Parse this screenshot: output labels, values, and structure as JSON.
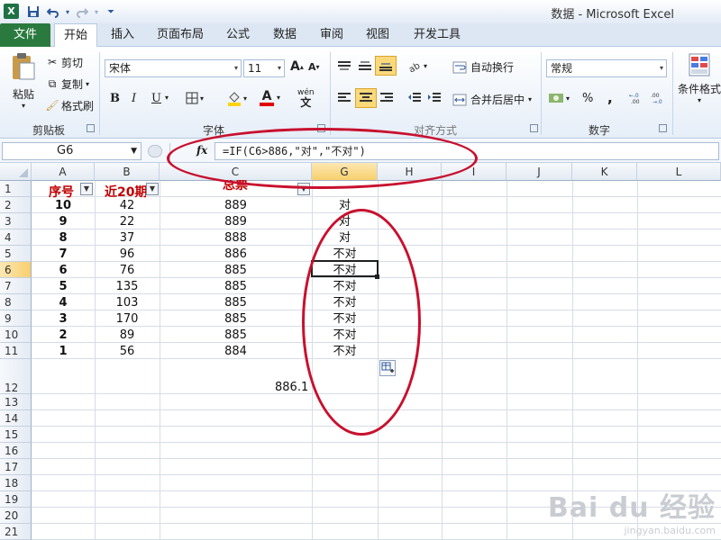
{
  "window": {
    "title": "数据 - Microsoft Excel",
    "app_icon": "X"
  },
  "quick_access": {
    "save": "save-icon",
    "undo": "undo-icon",
    "redo": "redo-icon",
    "customize": "customize-icon"
  },
  "tabs": [
    "文件",
    "开始",
    "插入",
    "页面布局",
    "公式",
    "数据",
    "审阅",
    "视图",
    "开发工具"
  ],
  "active_tab": "开始",
  "ribbon": {
    "clipboard": {
      "paste": "粘贴",
      "cut": "剪切",
      "copy": "复制",
      "format_painter": "格式刷",
      "group": "剪贴板"
    },
    "font": {
      "name": "宋体",
      "size": "11",
      "group": "字体",
      "bold": "B",
      "italic": "I",
      "underline": "U",
      "grow": "A",
      "shrink": "A",
      "font_color": "A",
      "phonetic": "wén"
    },
    "alignment": {
      "wrap": "自动换行",
      "merge": "合并后居中",
      "group": "对齐方式"
    },
    "number": {
      "format": "常规",
      "percent": "%",
      "comma": ",",
      "group": "数字"
    },
    "styles": {
      "conditional": "条件格式"
    }
  },
  "formula_bar": {
    "name_box": "G6",
    "fx": "fx",
    "formula": "=IF(C6>886,\"对\",\"不对\")"
  },
  "columns": [
    "A",
    "B",
    "C",
    "G",
    "H",
    "I",
    "J",
    "K",
    "L"
  ],
  "selected_column": "G",
  "selected_row": "6",
  "rows": [
    "1",
    "2",
    "3",
    "4",
    "5",
    "6",
    "7",
    "8",
    "9",
    "10",
    "11",
    "12",
    "13",
    "14",
    "15",
    "16",
    "17",
    "18",
    "19",
    "20",
    "21"
  ],
  "headers": {
    "A": "序号",
    "B": "近20期",
    "C": "总票"
  },
  "data_rows": [
    {
      "a": "10",
      "b": "42",
      "c": "889",
      "g": "对"
    },
    {
      "a": "9",
      "b": "22",
      "c": "889",
      "g": "对"
    },
    {
      "a": "8",
      "b": "37",
      "c": "888",
      "g": "对"
    },
    {
      "a": "7",
      "b": "96",
      "c": "886",
      "g": "不对"
    },
    {
      "a": "6",
      "b": "76",
      "c": "885",
      "g": "不对"
    },
    {
      "a": "5",
      "b": "135",
      "c": "885",
      "g": "不对"
    },
    {
      "a": "4",
      "b": "103",
      "c": "885",
      "g": "不对"
    },
    {
      "a": "3",
      "b": "170",
      "c": "885",
      "g": "不对"
    },
    {
      "a": "2",
      "b": "89",
      "c": "885",
      "g": "不对"
    },
    {
      "a": "1",
      "b": "56",
      "c": "884",
      "g": "不对"
    }
  ],
  "average_value": "886.1",
  "watermark": {
    "brand": "Bai du 经验",
    "url": "jingyan.baidu.com"
  },
  "colors": {
    "accent": "#2a7a3f",
    "header_text": "#c00000",
    "annotation": "#c8102e"
  }
}
